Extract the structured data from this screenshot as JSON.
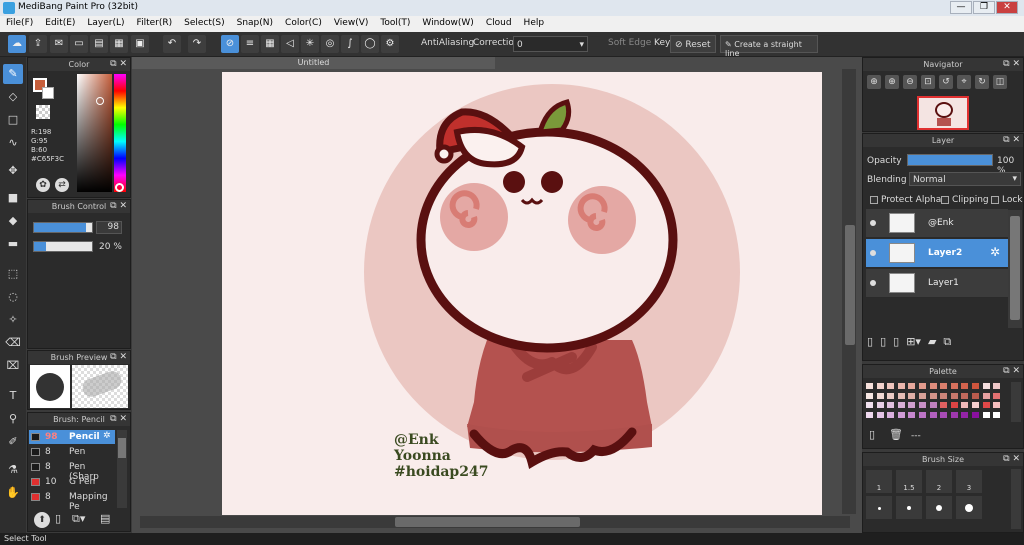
{
  "window": {
    "title": "MediBang Paint Pro (32bit)",
    "min": "—",
    "max": "❐",
    "close": "✕"
  },
  "menu": [
    "File(F)",
    "Edit(E)",
    "Layer(L)",
    "Filter(R)",
    "Select(S)",
    "Snap(N)",
    "Color(C)",
    "View(V)",
    "Tool(T)",
    "Window(W)",
    "Cloud",
    "Help"
  ],
  "toolbar": {
    "antialiasing": "AntiAliasing",
    "correction_label": "Correction",
    "correction_value": "0",
    "soft_edge": "Soft Edge",
    "key_label": "Key",
    "reset": "Reset",
    "straight_line": "Create a straight line"
  },
  "color_panel": {
    "title": "Color",
    "r": "R:198",
    "g": "G:95",
    "b": "B:60",
    "hex": "#C65F3C",
    "primary": "#C65F3C"
  },
  "brush_control": {
    "title": "Brush Control",
    "size": "98",
    "opacity": "20 %",
    "size_fill": 0.9,
    "opacity_fill": 0.2
  },
  "brush_preview": {
    "title": "Brush Preview"
  },
  "brush_list": {
    "title": "Brush: Pencil",
    "items": [
      {
        "size": "98",
        "name": "Pencil",
        "color": "#1a1a1a"
      },
      {
        "size": "8",
        "name": "Pen",
        "color": "#1a1a1a"
      },
      {
        "size": "8",
        "name": "Pen (Sharp",
        "color": "#1a1a1a"
      },
      {
        "size": "10",
        "name": "G Pen",
        "color": "#e03030"
      },
      {
        "size": "8",
        "name": "Mapping Pe",
        "color": "#e03030"
      }
    ]
  },
  "canvas": {
    "tab": "Untitled",
    "watermark_line1": "@Enk",
    "watermark_line2": "Yoonna",
    "watermark_line3": "#hoidap247"
  },
  "navigator": {
    "title": "Navigator"
  },
  "layer_panel": {
    "title": "Layer",
    "opacity_label": "Opacity",
    "opacity_value": "100 %",
    "blending_label": "Blending",
    "blending_value": "Normal",
    "protect_alpha": "Protect Alpha",
    "clipping": "Clipping",
    "lock": "Lock",
    "layers": [
      {
        "name": "@Enk"
      },
      {
        "name": "Layer2"
      },
      {
        "name": "Layer1"
      }
    ]
  },
  "palette": {
    "title": "Palette",
    "dashes": "---",
    "colors": [
      "#f7e1dc",
      "#f3d3cd",
      "#efc5bd",
      "#ebb7ad",
      "#e7a99d",
      "#e39b8d",
      "#df8d7d",
      "#db7f6d",
      "#d7715d",
      "#d3634d",
      "#cf553d",
      "#f5dede",
      "#f0c8c8",
      "#f7e7e3",
      "#f1d9d4",
      "#ebcbc5",
      "#e5bdb6",
      "#dfafa7",
      "#d9a198",
      "#d39389",
      "#cd857a",
      "#c7776b",
      "#c1695c",
      "#bb5b4d",
      "#e8a0a0",
      "#e27070",
      "#f0e0ee",
      "#e8d0e6",
      "#e0c0de",
      "#d8b0d6",
      "#d0a0ce",
      "#c890c6",
      "#c080be",
      "#e06060",
      "#dd4444",
      "#f0b8b8",
      "#f7cfcf",
      "#e04848",
      "#f8c0c0",
      "#eed8ee",
      "#e4c4e6",
      "#dab0de",
      "#d09cd6",
      "#c688ce",
      "#bc74c6",
      "#b260be",
      "#a84cb6",
      "#9e38ae",
      "#9424a6",
      "#8a109e",
      "#ffffff",
      "#ffffff"
    ]
  },
  "brush_size": {
    "title": "Brush Size",
    "sizes": [
      "1",
      "1.5",
      "2",
      "3"
    ]
  },
  "status": {
    "text": "Select Tool"
  }
}
